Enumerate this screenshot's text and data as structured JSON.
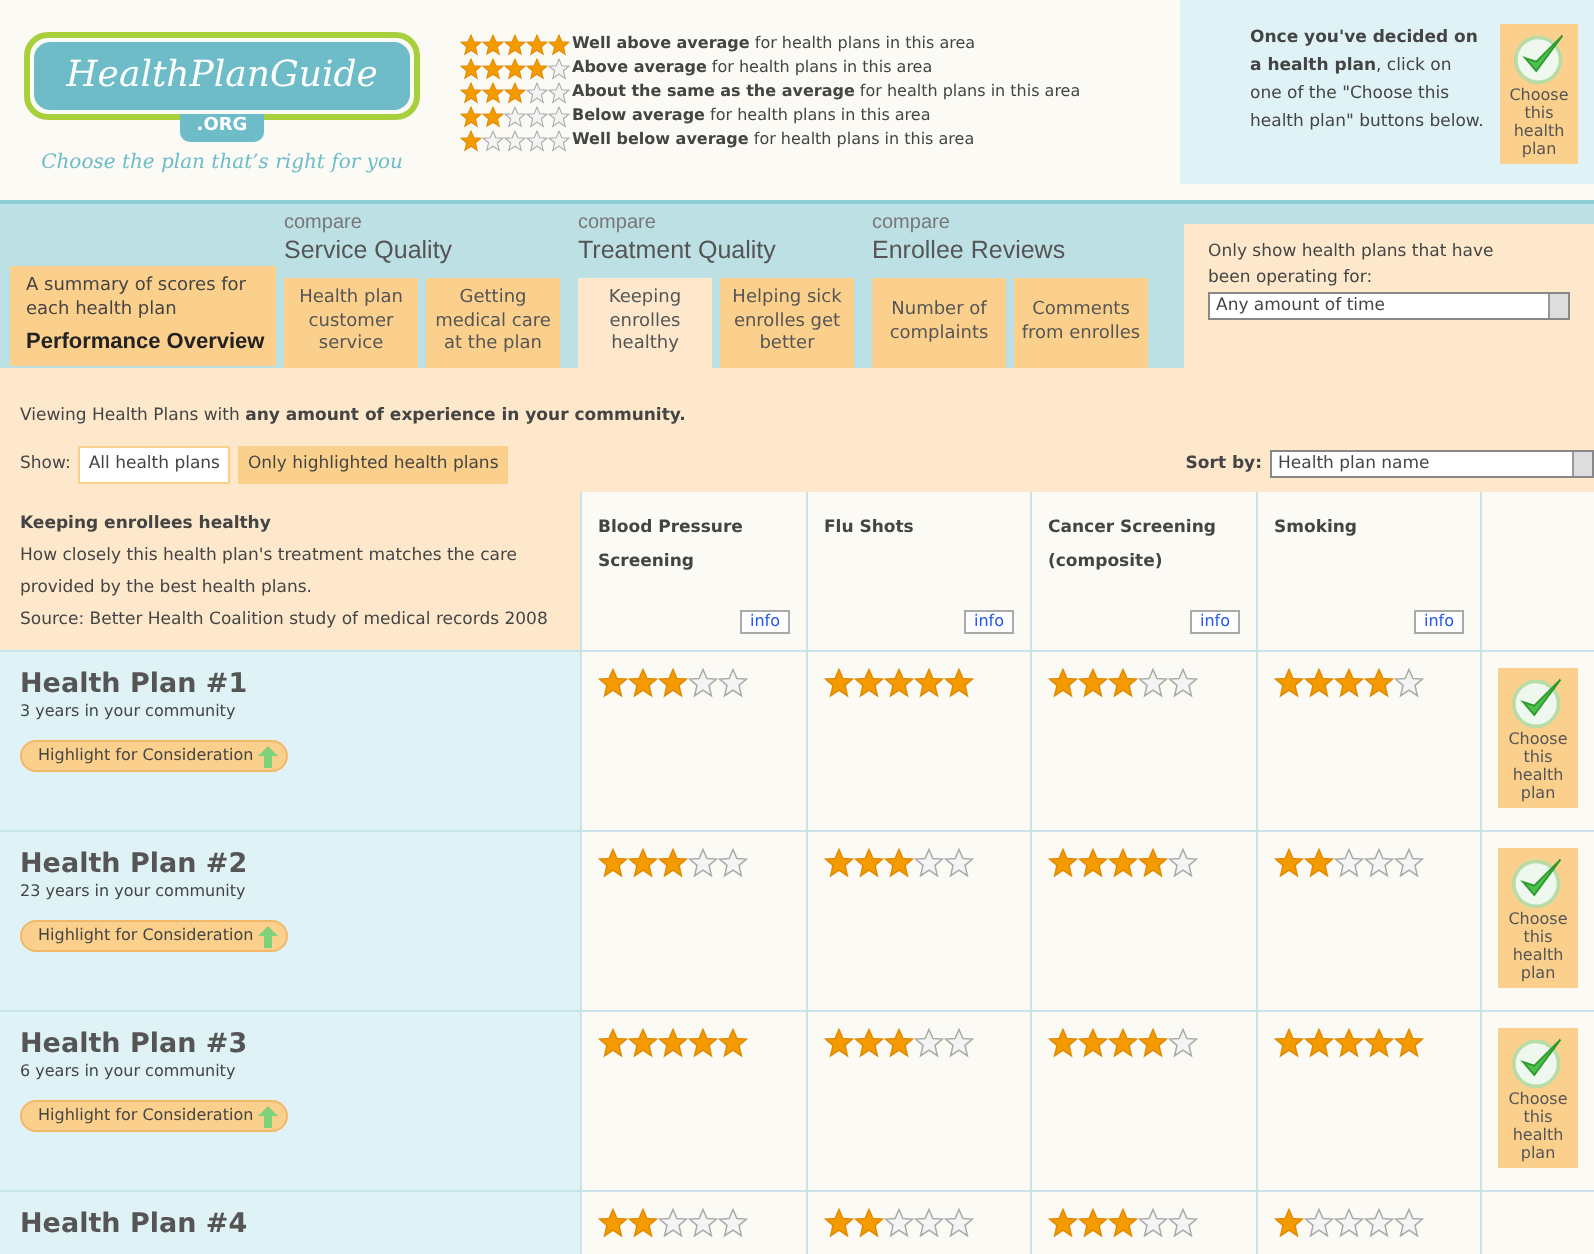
{
  "logo": {
    "name": "HealthPlanGuide",
    "suffix": ".ORG",
    "tagline": "Choose the plan that’s right for you"
  },
  "legend": [
    {
      "stars": 5,
      "text": "**Well above average** for health plans in this area"
    },
    {
      "stars": 4,
      "text": "**Above average** for health plans in this area"
    },
    {
      "stars": 3,
      "text": "**About the same as the average** for health plans in this area"
    },
    {
      "stars": 2,
      "text": "**Below average** for health plans in this area"
    },
    {
      "stars": 1,
      "text": "**Well below average** for health plans in this area"
    }
  ],
  "hint": {
    "text": "**Once you've decided on a health plan**, click on one of the \"Choose this health plan\" buttons below.",
    "button": "Choose this health plan"
  },
  "overview_tab": {
    "caption": "A summary of scores for each health plan",
    "title": "Performance Overview"
  },
  "groups": [
    {
      "compare": "compare",
      "title": "Service Quality",
      "tabs": [
        {
          "label": "Health plan customer service",
          "selected": false
        },
        {
          "label": "Getting medical care at the plan",
          "selected": false
        }
      ]
    },
    {
      "compare": "compare",
      "title": "Treatment Quality",
      "tabs": [
        {
          "label": "Keeping enrolles healthy",
          "selected": true
        },
        {
          "label": "Helping sick enrolles get better",
          "selected": false
        }
      ]
    },
    {
      "compare": "compare",
      "title": "Enrollee Reviews",
      "tabs": [
        {
          "label": "Number of complaints",
          "selected": false
        },
        {
          "label": "Comments from enrolles",
          "selected": false
        }
      ]
    }
  ],
  "filter": {
    "label": "Only show health plans that have been operating for:",
    "value": "Any amount of time"
  },
  "viewing": "Viewing Health Plans with **any amount of experience in your community.**",
  "show": {
    "label": "Show:",
    "options": [
      {
        "label": "All health plans",
        "selected": true
      },
      {
        "label": "Only highlighted health plans",
        "selected": false
      }
    ]
  },
  "sort": {
    "label": "Sort by:",
    "value": "Health plan name"
  },
  "table": {
    "intro": {
      "title": "Keeping enrollees healthy",
      "lines": [
        "How closely this health plan's treatment matches the care provided by the best health plans.",
        "Source: Better Health Coalition study of medical records 2008"
      ]
    },
    "columns": [
      {
        "title": "Blood Pressure Screening",
        "info": "info"
      },
      {
        "title": "Flu Shots",
        "info": "info"
      },
      {
        "title": "Cancer Screening (composite)",
        "info": "info"
      },
      {
        "title": "Smoking",
        "info": "info"
      }
    ],
    "rows": [
      {
        "name": "Health Plan #1",
        "years": "3 years in your community",
        "highlight": "Highlight for Consideration",
        "choose": "Choose this health plan",
        "stars": [
          3,
          5,
          3,
          4
        ]
      },
      {
        "name": "Health Plan #2",
        "years": "23 years in your community",
        "highlight": "Highlight for Consideration",
        "choose": "Choose this health plan",
        "stars": [
          3,
          3,
          4,
          2
        ]
      },
      {
        "name": "Health Plan #3",
        "years": "6 years in your community",
        "highlight": "Highlight for Consideration",
        "choose": "Choose this health plan",
        "stars": [
          5,
          3,
          4,
          5
        ]
      },
      {
        "name": "Health Plan #4",
        "stars": [
          2,
          2,
          3,
          1
        ]
      }
    ]
  }
}
